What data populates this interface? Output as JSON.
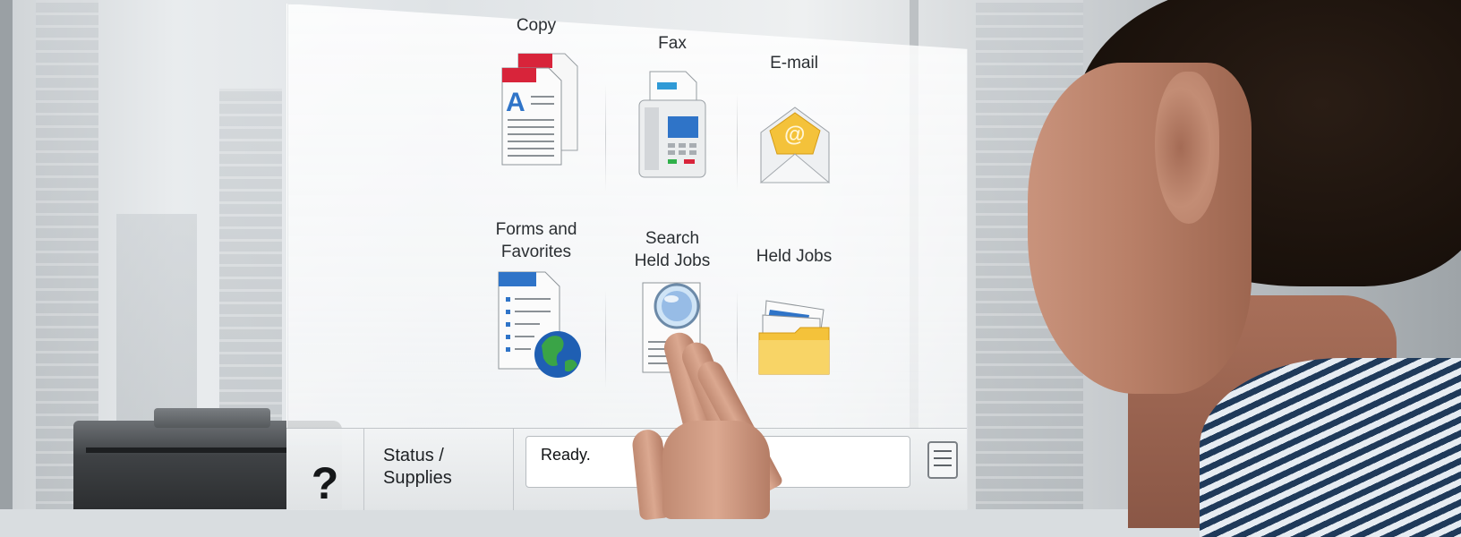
{
  "home_screen": {
    "tiles": [
      {
        "label": "Copy",
        "icon": "copy-icon"
      },
      {
        "label": "Fax",
        "icon": "fax-icon"
      },
      {
        "label": "E-mail",
        "icon": "email-icon"
      },
      {
        "label": "Forms and\nFavorites",
        "icon": "forms-favorites-icon"
      },
      {
        "label": "Search\nHeld Jobs",
        "icon": "search-held-jobs-icon"
      },
      {
        "label": "Held Jobs",
        "icon": "held-jobs-icon"
      }
    ]
  },
  "status_bar": {
    "help_label": "?",
    "status_supplies_label": "Status /\nSupplies",
    "message": "Ready.",
    "job_list_icon": "list-icon"
  },
  "colors": {
    "accent_blue": "#2f74c8",
    "accent_red": "#d8243a",
    "folder_yellow": "#f4c23a"
  }
}
